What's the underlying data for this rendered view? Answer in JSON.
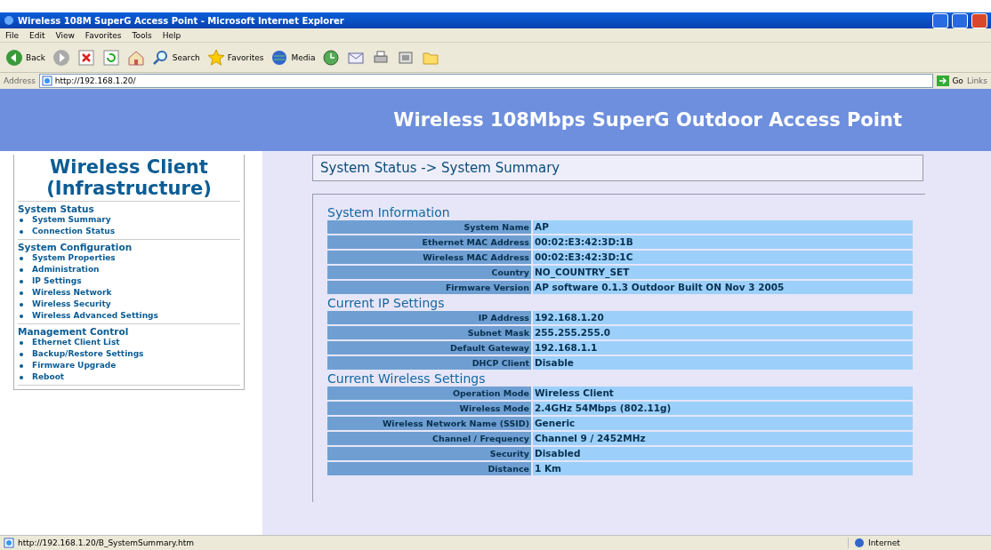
{
  "window": {
    "title": "Wireless 108M SuperG Access Point - Microsoft Internet Explorer"
  },
  "menu": [
    "File",
    "Edit",
    "View",
    "Favorites",
    "Tools",
    "Help"
  ],
  "toolbar": [
    {
      "kind": "back",
      "label": "Back"
    },
    {
      "kind": "forward"
    },
    {
      "kind": "stop"
    },
    {
      "kind": "refresh"
    },
    {
      "kind": "home"
    },
    {
      "kind": "search",
      "label": "Search"
    },
    {
      "kind": "favorites",
      "label": "Favorites"
    },
    {
      "kind": "media",
      "label": "Media"
    },
    {
      "kind": "history"
    },
    {
      "kind": "mail"
    },
    {
      "kind": "print"
    },
    {
      "kind": "edit"
    },
    {
      "kind": "folder"
    }
  ],
  "address": {
    "label": "Address",
    "value": "http://192.168.1.20/",
    "go": "Go",
    "links": "Links"
  },
  "banner": "Wireless 108Mbps SuperG Outdoor Access Point",
  "sidebar": {
    "title": "Wireless Client (Infrastructure)",
    "sections": [
      {
        "heading": "System Status",
        "items": [
          "System Summary",
          "Connection Status"
        ]
      },
      {
        "heading": "System Configuration",
        "items": [
          "System Properties",
          "Administration",
          "IP Settings",
          "Wireless Network",
          "Wireless Security",
          "Wireless Advanced Settings"
        ]
      },
      {
        "heading": "Management Control",
        "items": [
          "Ethernet Client List",
          "Backup/Restore Settings",
          "Firmware Upgrade",
          "Reboot"
        ]
      }
    ]
  },
  "breadcrumb": "System Status -> System Summary",
  "groups": [
    {
      "title": "System Information",
      "rows": [
        [
          "System Name",
          "AP"
        ],
        [
          "Ethernet MAC Address",
          "00:02:E3:42:3D:1B"
        ],
        [
          "Wireless MAC Address",
          "00:02:E3:42:3D:1C"
        ],
        [
          "Country",
          "NO_COUNTRY_SET"
        ],
        [
          "Firmware Version",
          "AP software 0.1.3 Outdoor Built ON Nov 3 2005"
        ]
      ]
    },
    {
      "title": "Current IP Settings",
      "rows": [
        [
          "IP Address",
          "192.168.1.20"
        ],
        [
          "Subnet Mask",
          "255.255.255.0"
        ],
        [
          "Default Gateway",
          "192.168.1.1"
        ],
        [
          "DHCP Client",
          "Disable"
        ]
      ]
    },
    {
      "title": "Current Wireless Settings",
      "rows": [
        [
          "Operation Mode",
          "Wireless Client"
        ],
        [
          "Wireless Mode",
          "2.4GHz 54Mbps (802.11g)"
        ],
        [
          "Wireless Network Name (SSID)",
          "Generic"
        ],
        [
          "Channel / Frequency",
          "Channel 9 / 2452MHz"
        ],
        [
          "Security",
          "Disabled"
        ],
        [
          "Distance",
          "1 Km"
        ]
      ]
    }
  ],
  "status_bar": {
    "url": "http://192.168.1.20/B_SystemSummary.htm",
    "zone": "Internet"
  }
}
